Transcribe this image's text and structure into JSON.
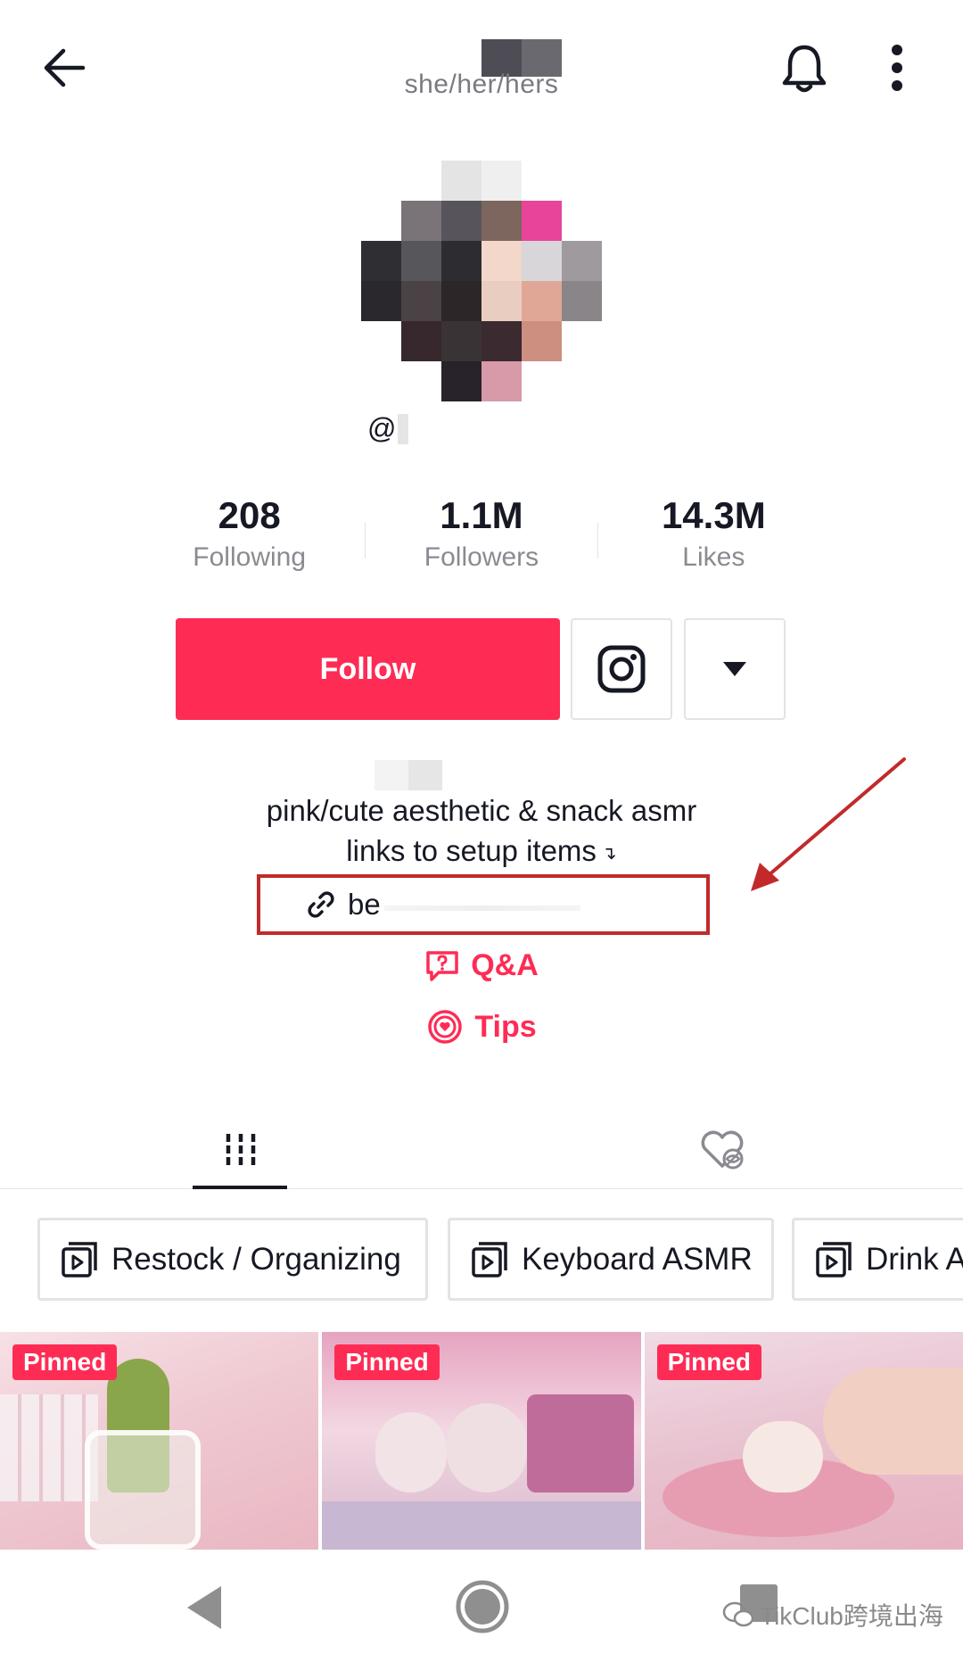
{
  "header": {
    "pronouns": "she/her/hers"
  },
  "profile": {
    "handle_prefix": "@"
  },
  "stats": [
    {
      "value": "208",
      "label": "Following"
    },
    {
      "value": "1.1M",
      "label": "Followers"
    },
    {
      "value": "14.3M",
      "label": "Likes"
    }
  ],
  "actions": {
    "follow_label": "Follow"
  },
  "bio": {
    "line1": "pink/cute aesthetic & snack asmr",
    "line2": "links to setup items",
    "line2_arrow": "↴",
    "link_text": "be"
  },
  "extras": {
    "qa_label": "Q&A",
    "tips_label": "Tips"
  },
  "playlists": [
    {
      "label": "Restock / Organizing"
    },
    {
      "label": "Keyboard ASMR"
    },
    {
      "label": "Drink A"
    }
  ],
  "videos": [
    {
      "badge": "Pinned"
    },
    {
      "badge": "Pinned"
    },
    {
      "badge": "Pinned"
    }
  ],
  "watermark": {
    "text": "TikClub跨境出海"
  },
  "colors": {
    "accent": "#fe2c55",
    "annotation_red": "#c22a2a",
    "text_primary": "#161823",
    "text_secondary": "#8a8b91"
  }
}
